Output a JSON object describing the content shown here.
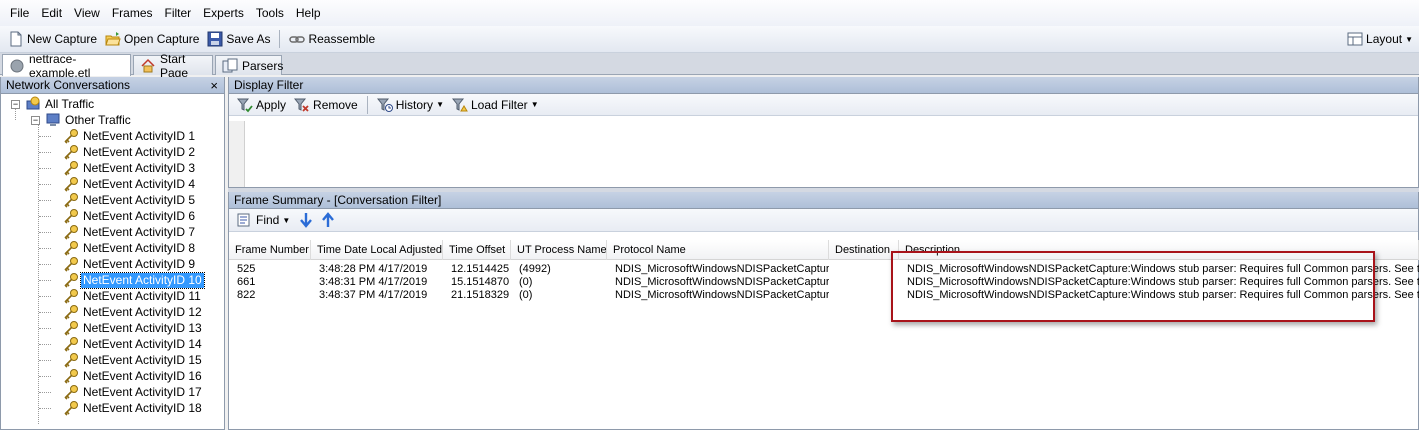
{
  "menu": [
    "File",
    "Edit",
    "View",
    "Frames",
    "Filter",
    "Experts",
    "Tools",
    "Help"
  ],
  "toolbar": {
    "new_capture": "New Capture",
    "open_capture": "Open Capture",
    "save_as": "Save As",
    "reassemble": "Reassemble",
    "layout": "Layout"
  },
  "doc_tabs": [
    "nettrace-example.etl",
    "Start Page",
    "Parsers"
  ],
  "left_pane": {
    "title": "Network Conversations",
    "close": "×",
    "root": "All Traffic",
    "group": "Other Traffic",
    "items": [
      "NetEvent ActivityID 1",
      "NetEvent ActivityID 2",
      "NetEvent ActivityID 3",
      "NetEvent ActivityID 4",
      "NetEvent ActivityID 5",
      "NetEvent ActivityID 6",
      "NetEvent ActivityID 7",
      "NetEvent ActivityID 8",
      "NetEvent ActivityID 9",
      "NetEvent ActivityID 10",
      "NetEvent ActivityID 11",
      "NetEvent ActivityID 12",
      "NetEvent ActivityID 13",
      "NetEvent ActivityID 14",
      "NetEvent ActivityID 15",
      "NetEvent ActivityID 16",
      "NetEvent ActivityID 17",
      "NetEvent ActivityID 18"
    ],
    "selected": "NetEvent ActivityID 10"
  },
  "display_filter": {
    "title": "Display Filter",
    "apply": "Apply",
    "remove": "Remove",
    "history": "History",
    "load_filter": "Load Filter"
  },
  "frame_summary": {
    "title": "Frame Summary - [Conversation Filter]",
    "find": "Find",
    "columns": [
      "Frame Number",
      "Time Date Local Adjusted",
      "Time Offset",
      "UT Process Name",
      "Protocol Name",
      "Destination",
      "Description"
    ],
    "rows": [
      [
        "525",
        "3:48:28 PM 4/17/2019",
        "12.1514425",
        "(4992)",
        "NDIS_MicrosoftWindowsNDISPacketCapture",
        "",
        "NDIS_MicrosoftWindowsNDISPacketCapture:Windows stub parser: Requires full Common parsers. See the \""
      ],
      [
        "661",
        "3:48:31 PM 4/17/2019",
        "15.1514870",
        "(0)",
        "NDIS_MicrosoftWindowsNDISPacketCapture",
        "",
        "NDIS_MicrosoftWindowsNDISPacketCapture:Windows stub parser: Requires full Common parsers. See the \""
      ],
      [
        "822",
        "3:48:37 PM 4/17/2019",
        "21.1518329",
        "(0)",
        "NDIS_MicrosoftWindowsNDISPacketCapture",
        "",
        "NDIS_MicrosoftWindowsNDISPacketCapture:Windows stub parser: Requires full Common parsers. See the \""
      ]
    ]
  },
  "colors": {
    "selection": "#3399ff",
    "highlight_box": "#a8131a",
    "pane_header": "#b8c7de"
  }
}
